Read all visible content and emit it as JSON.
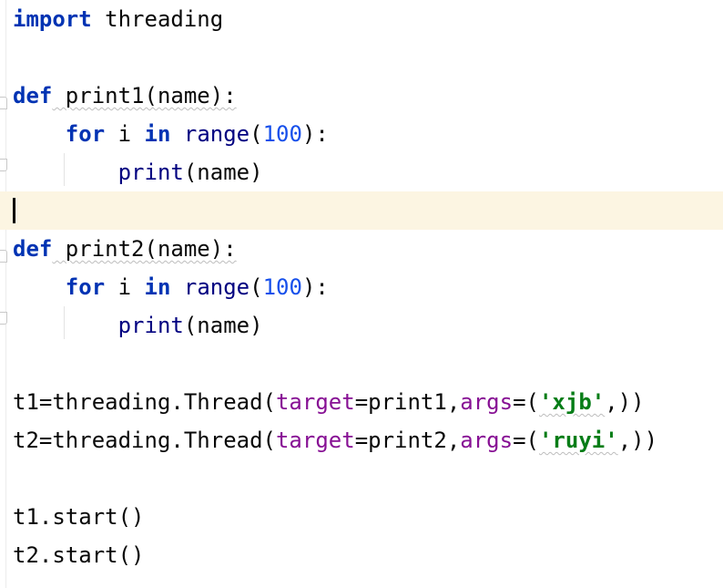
{
  "editor": {
    "language": "python",
    "lines": [
      {
        "tokens": [
          {
            "t": "import",
            "c": "kw"
          },
          {
            "t": " threading",
            "c": ""
          }
        ]
      },
      {
        "tokens": []
      },
      {
        "tokens": [
          {
            "t": "def",
            "c": "kw"
          },
          {
            "t": " print1(name):",
            "c": ""
          }
        ]
      },
      {
        "tokens": [
          {
            "t": "    ",
            "c": ""
          },
          {
            "t": "for",
            "c": "kw"
          },
          {
            "t": " i ",
            "c": ""
          },
          {
            "t": "in",
            "c": "kw"
          },
          {
            "t": " ",
            "c": ""
          },
          {
            "t": "range",
            "c": "builtin"
          },
          {
            "t": "(",
            "c": ""
          },
          {
            "t": "100",
            "c": "num"
          },
          {
            "t": "):",
            "c": ""
          }
        ]
      },
      {
        "tokens": [
          {
            "t": "        ",
            "c": ""
          },
          {
            "t": "print",
            "c": "builtin"
          },
          {
            "t": "(name)",
            "c": ""
          }
        ]
      },
      {
        "tokens": []
      },
      {
        "tokens": [
          {
            "t": "def",
            "c": "kw"
          },
          {
            "t": " print2(name):",
            "c": ""
          }
        ]
      },
      {
        "tokens": [
          {
            "t": "    ",
            "c": ""
          },
          {
            "t": "for",
            "c": "kw"
          },
          {
            "t": " i ",
            "c": ""
          },
          {
            "t": "in",
            "c": "kw"
          },
          {
            "t": " ",
            "c": ""
          },
          {
            "t": "range",
            "c": "builtin"
          },
          {
            "t": "(",
            "c": ""
          },
          {
            "t": "100",
            "c": "num"
          },
          {
            "t": "):",
            "c": ""
          }
        ]
      },
      {
        "tokens": [
          {
            "t": "        ",
            "c": ""
          },
          {
            "t": "print",
            "c": "builtin"
          },
          {
            "t": "(name)",
            "c": ""
          }
        ]
      },
      {
        "tokens": []
      },
      {
        "tokens": [
          {
            "t": "t1=threading.Thread(",
            "c": ""
          },
          {
            "t": "target",
            "c": "param"
          },
          {
            "t": "=print1,",
            "c": ""
          },
          {
            "t": "args",
            "c": "param"
          },
          {
            "t": "=(",
            "c": ""
          },
          {
            "t": "'xjb'",
            "c": "str"
          },
          {
            "t": ",))",
            "c": ""
          }
        ]
      },
      {
        "tokens": [
          {
            "t": "t2=threading.Thread(",
            "c": ""
          },
          {
            "t": "target",
            "c": "param"
          },
          {
            "t": "=print2,",
            "c": ""
          },
          {
            "t": "args",
            "c": "param"
          },
          {
            "t": "=(",
            "c": ""
          },
          {
            "t": "'ruyi'",
            "c": "str"
          },
          {
            "t": ",))",
            "c": ""
          }
        ]
      },
      {
        "tokens": []
      },
      {
        "tokens": [
          {
            "t": "t1.start()",
            "c": ""
          }
        ]
      },
      {
        "tokens": [
          {
            "t": "t2.start()",
            "c": ""
          }
        ]
      }
    ],
    "current_line": 5,
    "colors": {
      "keyword": "#0033b3",
      "number": "#1750eb",
      "builtin": "#000080",
      "param": "#871094",
      "string": "#067d17",
      "current_line_bg": "#fcf5e2"
    }
  }
}
